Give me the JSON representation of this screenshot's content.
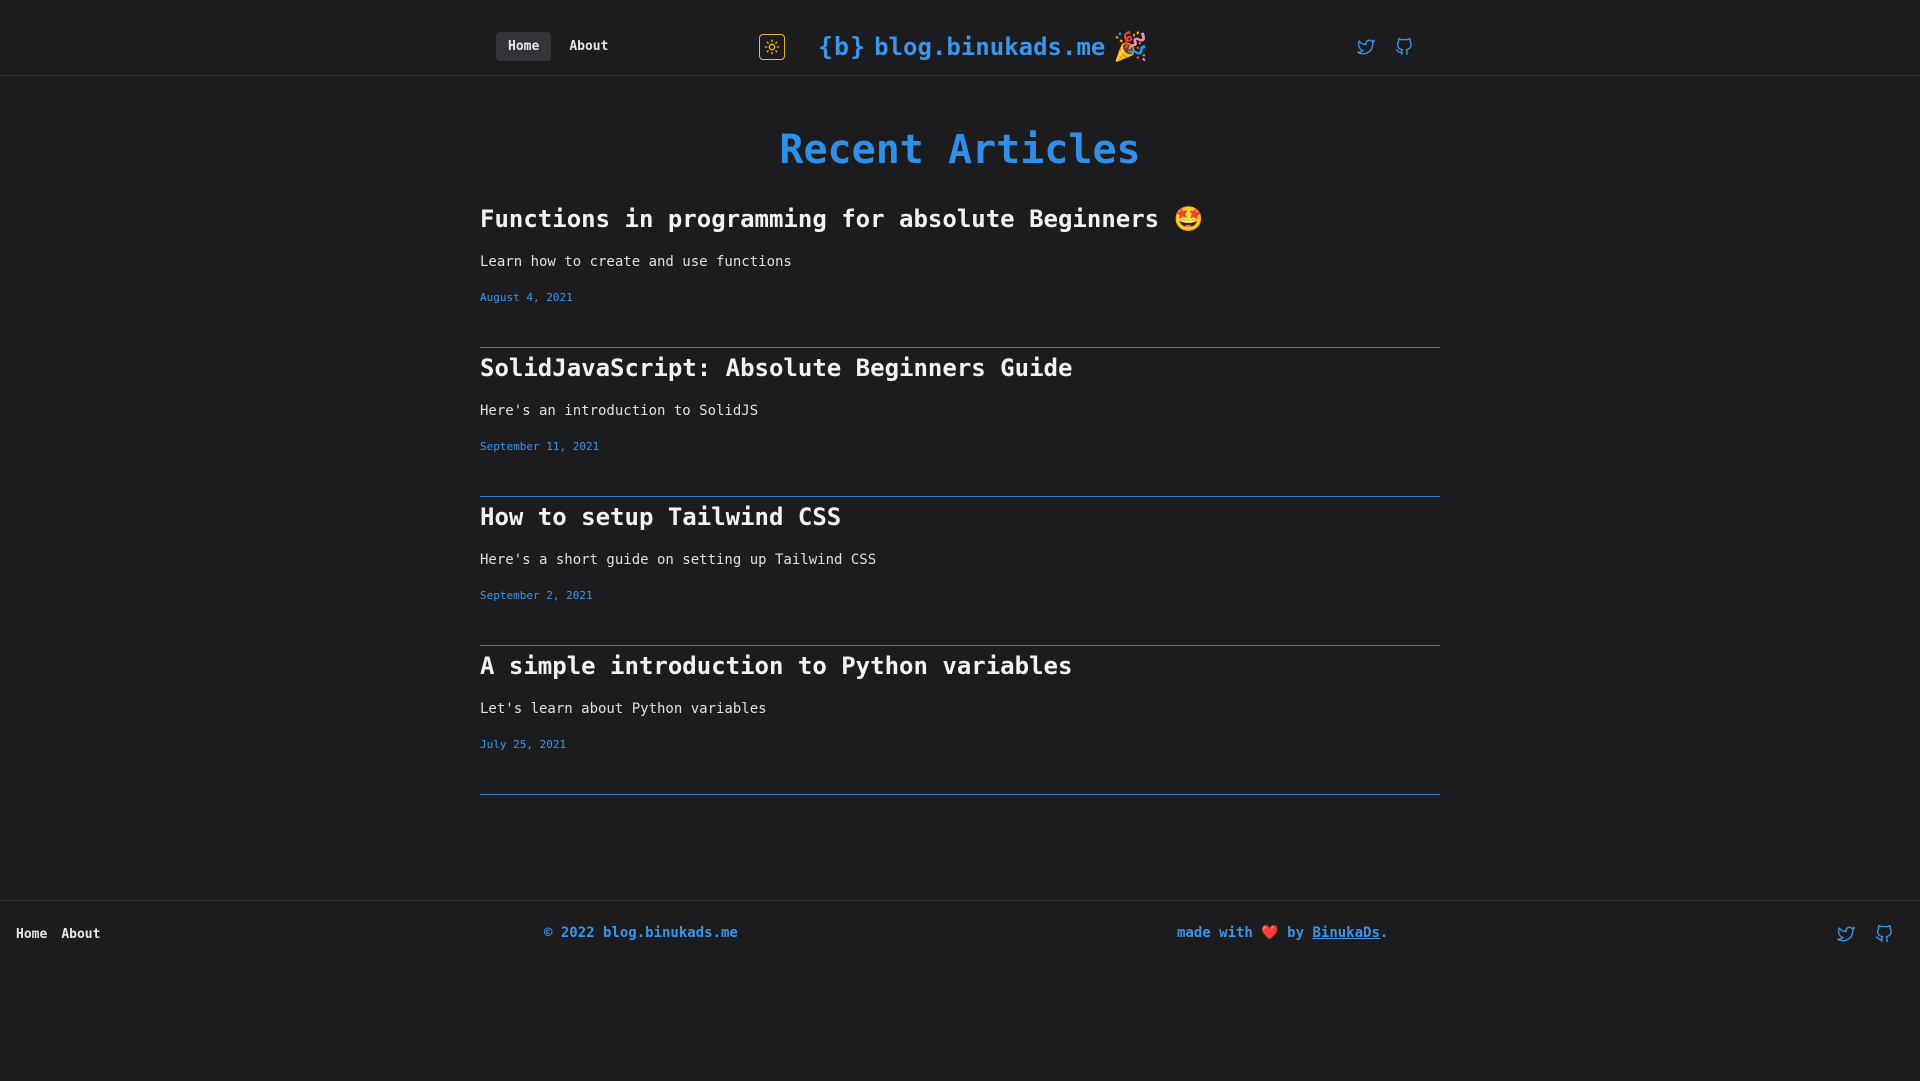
{
  "header": {
    "nav": [
      {
        "label": "Home"
      },
      {
        "label": "About"
      }
    ],
    "brand_logo": "{b}",
    "brand_name": "blog.binukads.me",
    "brand_emoji": "🎉",
    "social_icons": [
      "twitter-icon",
      "github-icon"
    ],
    "theme_icon": "sun-icon"
  },
  "main": {
    "title": "Recent Articles",
    "articles": [
      {
        "title": "Functions in programming for absolute Beginners 🤩",
        "description": "Learn how to create and use functions",
        "date": "August 4, 2021"
      },
      {
        "title": "SolidJavaScript: Absolute Beginners Guide",
        "description": "Here's an introduction to SolidJS",
        "date": "September 11, 2021"
      },
      {
        "title": "How to setup Tailwind CSS",
        "description": "Here's a short guide on setting up Tailwind CSS",
        "date": "September 2, 2021"
      },
      {
        "title": "A simple introduction to Python variables",
        "description": "Let's learn about Python variables",
        "date": "July 25, 2021"
      }
    ]
  },
  "footer": {
    "nav": [
      {
        "label": "Home"
      },
      {
        "label": "About"
      }
    ],
    "copyright": "© 2022 blog.binukads.me",
    "made_with_prefix": "made with",
    "heart": "❤️",
    "by": "by",
    "author": "BinukaDs",
    "suffix": "."
  },
  "colors": {
    "accent": "#3b95e8",
    "background": "#1c1c1e",
    "theme_toggle": "#e8b923"
  }
}
